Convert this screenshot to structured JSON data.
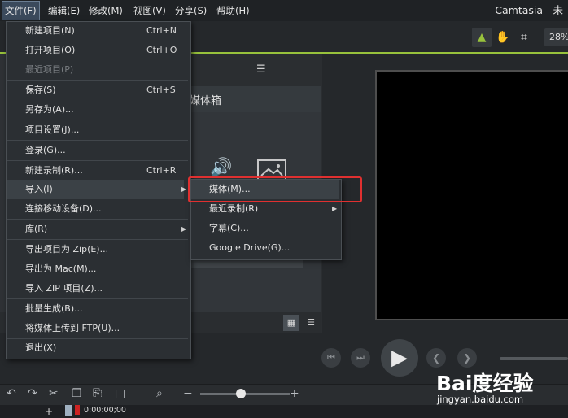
{
  "menubar": {
    "items": [
      "文件(F)",
      "编辑(E)",
      "修改(M)",
      "视图(V)",
      "分享(S)",
      "帮助(H)"
    ],
    "app_title": "Camtasia - 未"
  },
  "toolbar": {
    "zoom": "28%"
  },
  "media_bin": {
    "title": "媒体箱"
  },
  "file_menu": {
    "items": [
      {
        "label": "新建项目(N)",
        "shortcut": "Ctrl+N"
      },
      {
        "label": "打开项目(O)",
        "shortcut": "Ctrl+O"
      },
      {
        "label": "最近项目(P)",
        "disabled": true
      },
      {
        "label": "保存(S)",
        "shortcut": "Ctrl+S"
      },
      {
        "label": "另存为(A)..."
      },
      {
        "label": "项目设置(J)..."
      },
      {
        "label": "登录(G)..."
      },
      {
        "label": "新建录制(R)...",
        "shortcut": "Ctrl+R"
      },
      {
        "label": "导入(I)",
        "submenu": true
      },
      {
        "label": "连接移动设备(D)..."
      },
      {
        "label": "库(R)",
        "submenu": true
      },
      {
        "label": "导出项目为 Zip(E)..."
      },
      {
        "label": "导出为 Mac(M)..."
      },
      {
        "label": "导入 ZIP 项目(Z)..."
      },
      {
        "label": "批量生成(B)..."
      },
      {
        "label": "将媒体上传到 FTP(U)..."
      },
      {
        "label": "退出(X)"
      }
    ]
  },
  "import_menu": {
    "items": [
      {
        "label": "媒体(M)..."
      },
      {
        "label": "最近录制(R)",
        "submenu": true
      },
      {
        "label": "字幕(C)..."
      },
      {
        "label": "Google Drive(G)..."
      }
    ]
  },
  "timeline": {
    "timecode": "0:00:00;00"
  },
  "watermark": {
    "logo": "Bai度经验",
    "subtitle": "jingyan.baidu.com"
  },
  "colors": {
    "accent": "#98c23c",
    "highlight": "#e03030"
  }
}
